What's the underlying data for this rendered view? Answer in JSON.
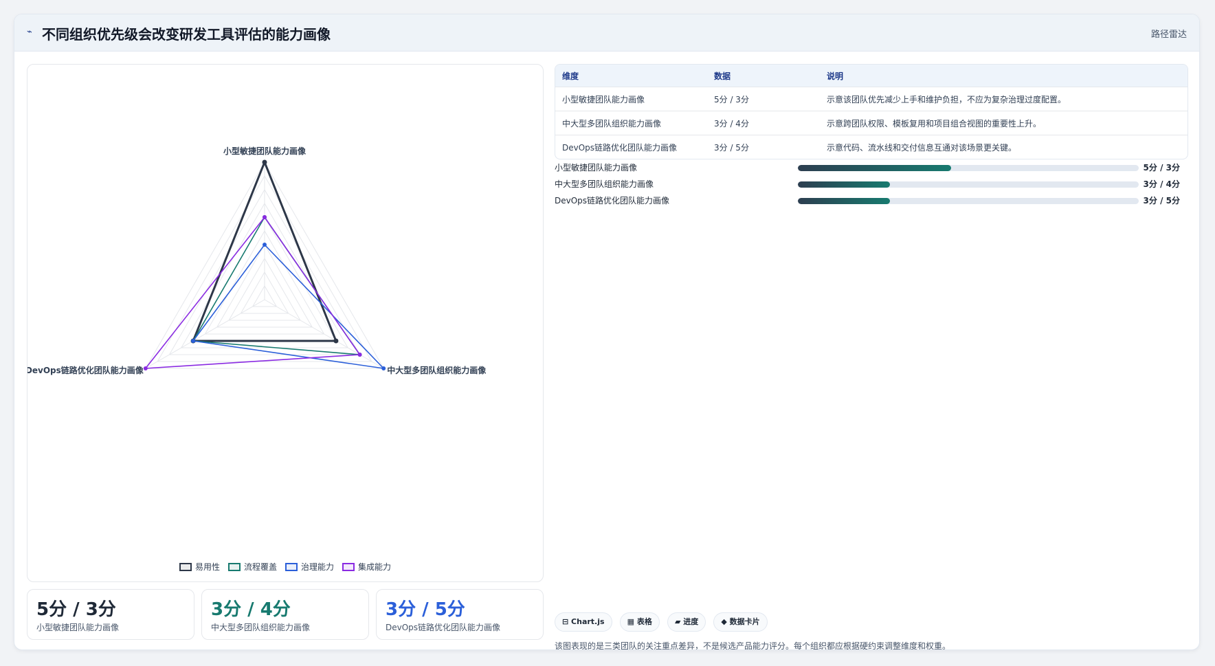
{
  "header": {
    "icon": "chart-line-icon",
    "title": "不同组织优先级会改变研发工具评估的能力画像",
    "tag": "路径雷达"
  },
  "chart_data": {
    "type": "radar",
    "axes": [
      "小型敏捷团队能力画像",
      "中大型多团队组织能力画像",
      "DevOps链路优化团队能力画像"
    ],
    "rmax": 5,
    "series": [
      {
        "name": "易用性",
        "color": "#2d3748",
        "values": [
          5,
          3,
          3
        ]
      },
      {
        "name": "流程覆盖",
        "color": "#177a6f",
        "values": [
          3,
          4,
          3
        ]
      },
      {
        "name": "治理能力",
        "color": "#2b5fd9",
        "values": [
          2,
          5,
          3
        ]
      },
      {
        "name": "集成能力",
        "color": "#8a2be2",
        "values": [
          3,
          4,
          5
        ]
      }
    ],
    "legend": "bottom"
  },
  "stats": [
    {
      "value": "5分 / 3分",
      "label": "小型敏捷团队能力画像",
      "color": "#1f2937"
    },
    {
      "value": "3分 / 4分",
      "label": "中大型多团队组织能力画像",
      "color": "#177a6f"
    },
    {
      "value": "3分 / 5分",
      "label": "DevOps链路优化团队能力画像",
      "color": "#2b5fd9"
    }
  ],
  "table": {
    "headers": [
      "维度",
      "数据",
      "说明"
    ],
    "rows": [
      [
        "小型敏捷团队能力画像",
        "5分 / 3分",
        "示意该团队优先减少上手和维护负担，不应为复杂治理过度配置。"
      ],
      [
        "中大型多团队组织能力画像",
        "3分 / 4分",
        "示意跨团队权限、模板复用和项目组合视图的重要性上升。"
      ],
      [
        "DevOps链路优化团队能力画像",
        "3分 / 5分",
        "示意代码、流水线和交付信息互通对该场景更关键。"
      ]
    ]
  },
  "progress": [
    {
      "label": "小型敏捷团队能力画像",
      "value": "5分 / 3分",
      "fraction": 0.45
    },
    {
      "label": "中大型多团队组织能力画像",
      "value": "3分 / 4分",
      "fraction": 0.27
    },
    {
      "label": "DevOps链路优化团队能力画像",
      "value": "3分 / 5分",
      "fraction": 0.27
    }
  ],
  "chips": [
    {
      "label": "⊟ Chart.js",
      "icon": "chart-icon"
    },
    {
      "label": "▦ 表格",
      "icon": "table-icon"
    },
    {
      "label": "▰ 进度",
      "icon": "progress-icon"
    },
    {
      "label": "◆ 数据卡片",
      "icon": "card-icon"
    }
  ],
  "footnote": "该图表现的是三类团队的关注重点差异，不是候选产品能力评分。每个组织都应根据硬约束调整维度和权重。"
}
